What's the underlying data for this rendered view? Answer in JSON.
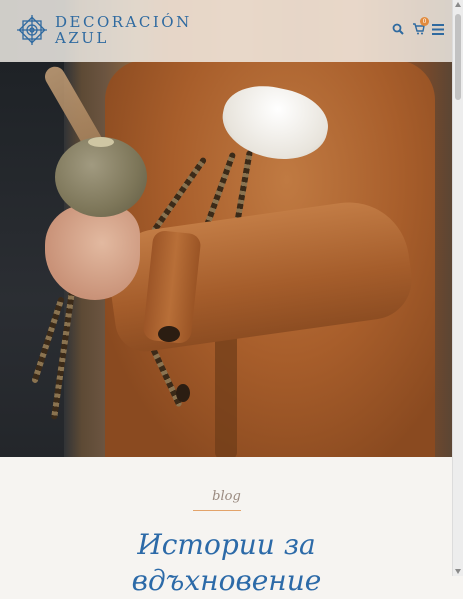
{
  "brand": {
    "line1": "DECORACIÓN",
    "line2": "AZUL",
    "color": "#2f6aa0"
  },
  "header": {
    "icons": [
      "search-icon",
      "cart-icon",
      "menu-icon"
    ],
    "cart_count": "0",
    "badge_color": "#e28a3c"
  },
  "section": {
    "label": "blog",
    "heading_line1": "Истории за",
    "heading_line2": "вдъхновение",
    "heading_color": "#2c6aa8",
    "accent_color": "#e3a36a"
  }
}
